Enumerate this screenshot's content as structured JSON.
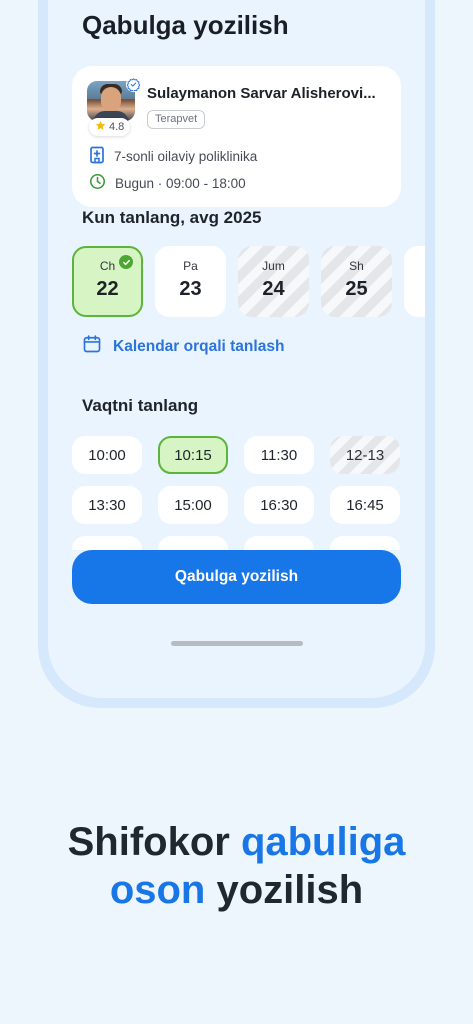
{
  "screen": {
    "title": "Qabulga yozilish"
  },
  "doctor": {
    "name": "Sulaymanon Sarvar Alisherovi...",
    "specialty": "Terapvet",
    "rating": "4.8",
    "clinic": "7-sonli oilaviy poliklinika",
    "hours": "Bugun · 09:00 - 18:00"
  },
  "day_section": {
    "label": "Kun tanlang, avg  2025",
    "days": [
      {
        "name": "Ch",
        "num": "22",
        "state": "selected"
      },
      {
        "name": "Pa",
        "num": "23",
        "state": "available"
      },
      {
        "name": "Jum",
        "num": "24",
        "state": "disabled"
      },
      {
        "name": "Sh",
        "num": "25",
        "state": "disabled"
      }
    ],
    "calendar_link": "Kalendar orqali tanlash"
  },
  "time_section": {
    "label": "Vaqtni tanlang",
    "slots": [
      {
        "time": "10:00",
        "state": "available"
      },
      {
        "time": "10:15",
        "state": "selected"
      },
      {
        "time": "11:30",
        "state": "available"
      },
      {
        "time": "12-13",
        "state": "disabled"
      },
      {
        "time": "13:30",
        "state": "available"
      },
      {
        "time": "15:00",
        "state": "available"
      },
      {
        "time": "16:30",
        "state": "available"
      },
      {
        "time": "16:45",
        "state": "available"
      }
    ]
  },
  "book_button": "Qabulga yozilish",
  "tagline": {
    "part1": "Shifokor ",
    "part2": "qabuliga",
    "part3": "oson",
    "part4": " yozilish"
  },
  "colors": {
    "accent": "#1976e6",
    "selected_bg": "#d7f5c4",
    "selected_border": "#5cb43a",
    "verified": "#2b74dc"
  },
  "icons": {
    "rating": "star-icon",
    "clinic": "hospital-icon",
    "hours": "clock-icon",
    "calendar": "calendar-icon",
    "verified": "verified-icon",
    "check": "check-icon"
  }
}
